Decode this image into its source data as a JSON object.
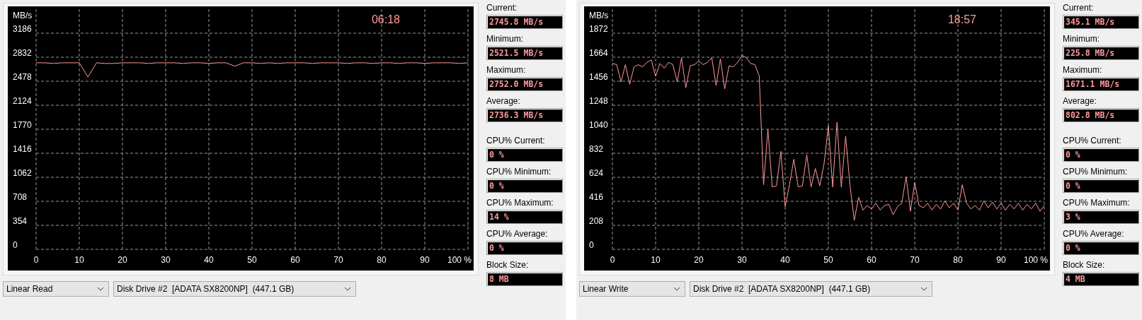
{
  "panels": [
    {
      "timer": "06:18",
      "chart_data": {
        "type": "line",
        "ylabel": "MB/s",
        "xlim": [
          0,
          100
        ],
        "ylim": [
          0,
          3540
        ],
        "grid": true,
        "xticks": [
          0,
          10,
          20,
          30,
          40,
          50,
          60,
          70,
          80,
          90,
          {
            "value": 100,
            "label": "100 %"
          }
        ],
        "yticks": [
          0,
          354,
          708,
          1062,
          1416,
          1770,
          2124,
          2478,
          2832,
          3186
        ],
        "x": [
          0,
          2,
          4,
          6,
          8,
          10,
          12,
          14,
          16,
          18,
          20,
          22,
          24,
          26,
          28,
          30,
          32,
          34,
          36,
          38,
          40,
          42,
          44,
          46,
          48,
          50,
          52,
          54,
          56,
          58,
          60,
          62,
          64,
          66,
          68,
          70,
          72,
          74,
          76,
          78,
          80,
          82,
          84,
          86,
          88,
          90,
          92,
          94,
          96,
          98,
          100
        ],
        "series": [
          {
            "color": "#ff9a9a",
            "values": [
              2750,
              2750,
              2740,
              2750,
              2750,
              2750,
              2540,
              2750,
              2740,
              2740,
              2750,
              2750,
              2750,
              2740,
              2750,
              2750,
              2750,
              2740,
              2750,
              2750,
              2740,
              2750,
              2750,
              2700,
              2750,
              2750,
              2740,
              2750,
              2740,
              2750,
              2750,
              2750,
              2740,
              2750,
              2750,
              2750,
              2740,
              2750,
              2750,
              2740,
              2750,
              2750,
              2740,
              2750,
              2750,
              2740,
              2750,
              2750,
              2750,
              2740,
              2750
            ]
          }
        ]
      },
      "throughput_stats": [
        {
          "label": "Current:",
          "value": "2745.8 MB/s"
        },
        {
          "label": "Minimum:",
          "value": "2521.5 MB/s"
        },
        {
          "label": "Maximum:",
          "value": "2752.0 MB/s"
        },
        {
          "label": "Average:",
          "value": "2736.3 MB/s"
        }
      ],
      "cpu_stats": [
        {
          "label": "CPU% Current:",
          "value": "0 %"
        },
        {
          "label": "CPU% Minimum:",
          "value": "0 %"
        },
        {
          "label": "CPU% Maximum:",
          "value": "14 %"
        },
        {
          "label": "CPU% Average:",
          "value": "0 %"
        }
      ],
      "block_size": {
        "label": "Block Size:",
        "value": "8 MB"
      },
      "test_mode": "Linear Read",
      "drive": "Disk Drive #2  [ADATA SX8200NP]  (447.1 GB)"
    },
    {
      "timer": "18:57",
      "chart_data": {
        "type": "line",
        "ylabel": "MB/s",
        "xlim": [
          0,
          100
        ],
        "ylim": [
          0,
          2080
        ],
        "grid": true,
        "xticks": [
          0,
          10,
          20,
          30,
          40,
          50,
          60,
          70,
          80,
          90,
          {
            "value": 100,
            "label": "100 %"
          }
        ],
        "yticks": [
          0,
          208,
          416,
          624,
          832,
          1040,
          1248,
          1456,
          1664,
          1872
        ],
        "x": [
          0,
          1,
          2,
          3,
          4,
          5,
          6,
          7,
          8,
          9,
          10,
          11,
          12,
          13,
          14,
          15,
          16,
          17,
          18,
          19,
          20,
          21,
          22,
          23,
          24,
          25,
          26,
          27,
          28,
          29,
          30,
          31,
          32,
          33,
          34,
          35,
          36,
          37,
          38,
          39,
          40,
          41,
          42,
          43,
          44,
          45,
          46,
          47,
          48,
          49,
          50,
          51,
          52,
          53,
          54,
          55,
          56,
          57,
          58,
          59,
          60,
          61,
          62,
          63,
          64,
          65,
          66,
          67,
          68,
          69,
          70,
          71,
          72,
          73,
          74,
          75,
          76,
          77,
          78,
          79,
          80,
          81,
          82,
          83,
          84,
          85,
          86,
          87,
          88,
          89,
          90,
          91,
          92,
          93,
          94,
          95,
          96,
          97,
          98,
          99,
          100
        ],
        "series": [
          {
            "color": "#ff9a9a",
            "values": [
              1610,
              1600,
              1450,
              1600,
              1430,
              1580,
              1600,
              1580,
              1620,
              1640,
              1500,
              1610,
              1570,
              1620,
              1600,
              1450,
              1660,
              1400,
              1590,
              1600,
              1630,
              1600,
              1620,
              1660,
              1420,
              1650,
              1390,
              1590,
              1580,
              1620,
              1680,
              1660,
              1610,
              1600,
              1500,
              560,
              1040,
              540,
              550,
              850,
              370,
              560,
              780,
              540,
              550,
              820,
              540,
              700,
              550,
              740,
              1070,
              540,
              1100,
              540,
              980,
              560,
              250,
              450,
              340,
              380,
              350,
              400,
              340,
              380,
              390,
              300,
              370,
              400,
              630,
              330,
              580,
              380,
              360,
              400,
              340,
              390,
              350,
              420,
              360,
              400,
              340,
              560,
              400,
              350,
              380,
              340,
              420,
              360,
              410,
              350,
              400,
              340,
              390,
              350,
              400,
              340,
              390,
              350,
              400,
              330,
              380
            ]
          }
        ]
      },
      "throughput_stats": [
        {
          "label": "Current:",
          "value": "345.1 MB/s"
        },
        {
          "label": "Minimum:",
          "value": "225.8 MB/s"
        },
        {
          "label": "Maximum:",
          "value": "1671.1 MB/s"
        },
        {
          "label": "Average:",
          "value": "802.8 MB/s"
        }
      ],
      "cpu_stats": [
        {
          "label": "CPU% Current:",
          "value": "0 %"
        },
        {
          "label": "CPU% Minimum:",
          "value": "0 %"
        },
        {
          "label": "CPU% Maximum:",
          "value": "3 %"
        },
        {
          "label": "CPU% Average:",
          "value": "0 %"
        }
      ],
      "block_size": {
        "label": "Block Size:",
        "value": "4 MB"
      },
      "test_mode": "Linear Write",
      "drive": "Disk Drive #2  [ADATA SX8200NP]  (447.1 GB)"
    }
  ]
}
